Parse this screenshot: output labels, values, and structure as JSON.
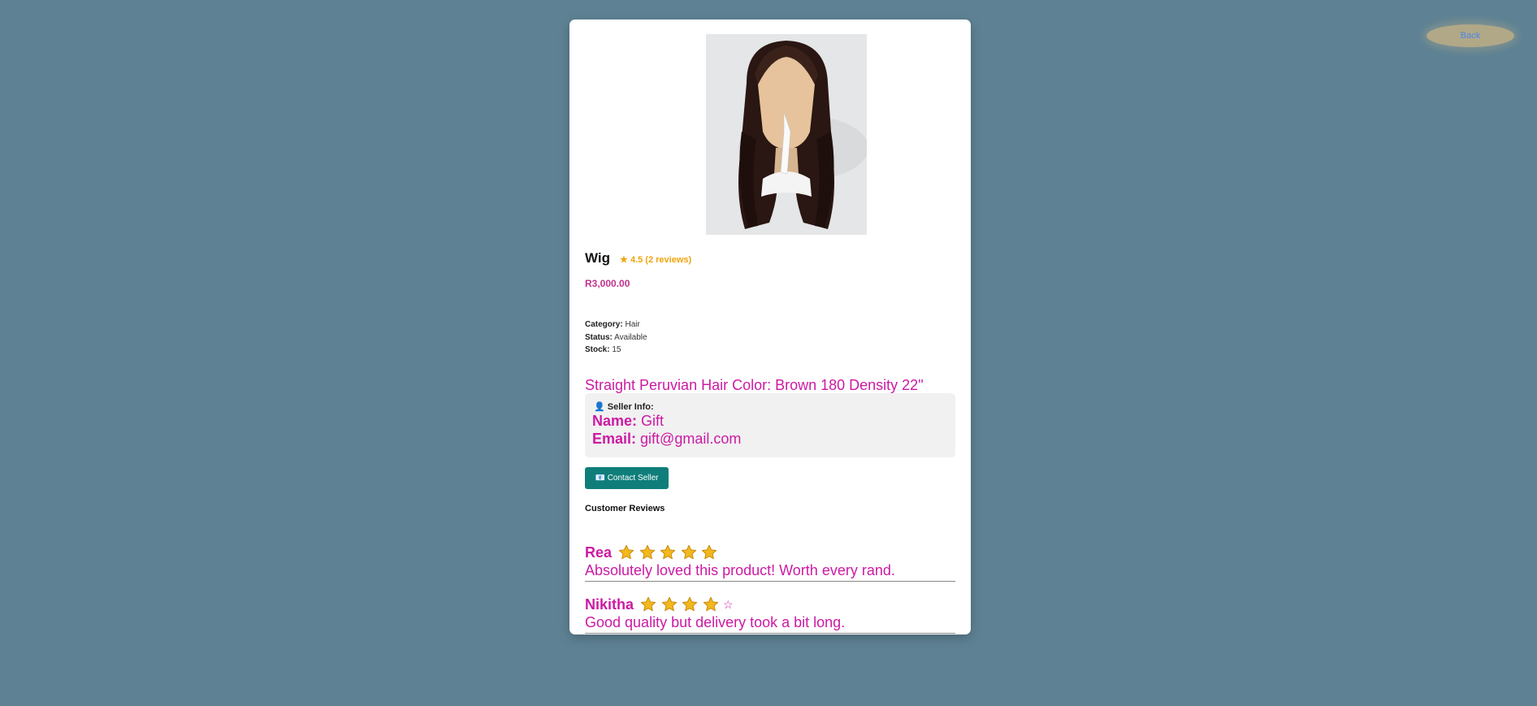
{
  "back_label": "Back",
  "product": {
    "title": "Wig",
    "rating_text": "4.5 (2 reviews)",
    "price": "R3,000.00",
    "category_label": "Category:",
    "category": "Hair",
    "status_label": "Status:",
    "status": "Available",
    "stock_label": "Stock:",
    "stock": "15",
    "description": "Straight Peruvian Hair Color: Brown 180 Density 22\""
  },
  "seller": {
    "heading": "Seller Info:",
    "name_label": "Name:",
    "name": "Gift",
    "email_label": "Email:",
    "email": "gift@gmail.com"
  },
  "contact_button": "Contact Seller",
  "reviews_heading": "Customer Reviews",
  "reviews": [
    {
      "name": "Rea",
      "stars": 5,
      "text": "Absolutely loved this product! Worth every rand."
    },
    {
      "name": "Nikitha",
      "stars": 4,
      "text": "Good quality but delivery took a bit long."
    }
  ],
  "colors": {
    "background": "#5e8294",
    "accent": "#cc1aa4",
    "rating": "#f0a30a",
    "button": "#0f7e7a"
  }
}
